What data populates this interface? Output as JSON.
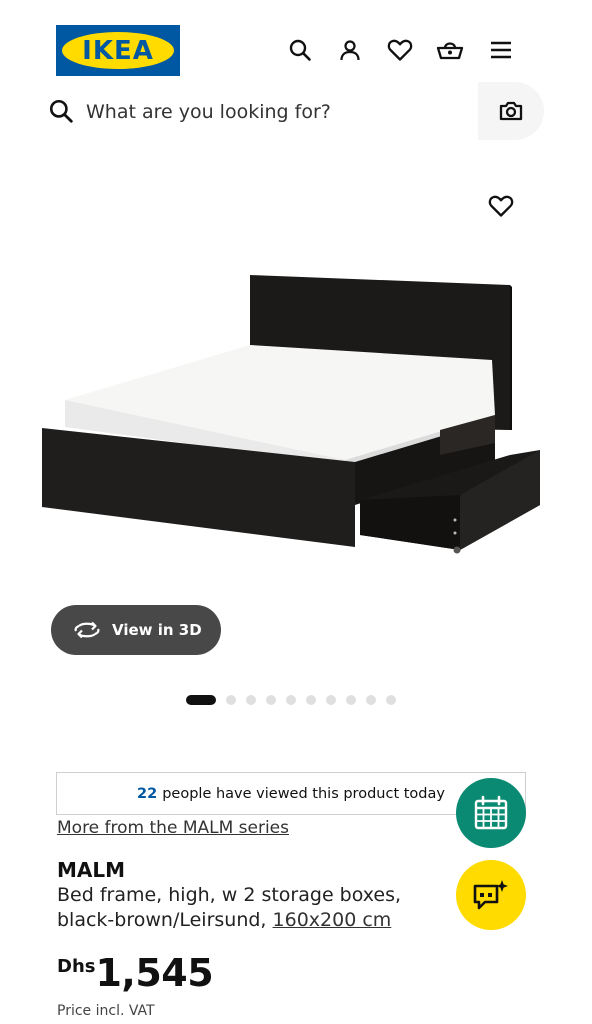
{
  "header": {
    "logo_text": "IKEA",
    "icons": [
      "search-icon",
      "user-icon",
      "heart-icon",
      "basket-icon",
      "menu-icon"
    ]
  },
  "search": {
    "placeholder": "What are you looking for?",
    "camera_icon": "camera-icon"
  },
  "gallery": {
    "view3d_label": "View in 3D",
    "dot_count": 10,
    "active_index": 0
  },
  "social_proof": {
    "count": "22",
    "text": "people have viewed this product today"
  },
  "product": {
    "series_link": "More from the MALM series",
    "name": "MALM",
    "description": "Bed frame, high, w 2 storage boxes, black-brown/Leirsund,",
    "size_link": "160x200 cm",
    "currency": "Dhs",
    "price": "1,545",
    "price_note": "Price incl. VAT"
  },
  "fabs": {
    "planner_icon": "calendar-icon",
    "chat_icon": "chat-sparkle-icon"
  },
  "colors": {
    "ikea_blue": "#0058a3",
    "ikea_yellow": "#ffdb00",
    "planner_green": "#0a8a72",
    "view3d_bg": "#484848"
  }
}
